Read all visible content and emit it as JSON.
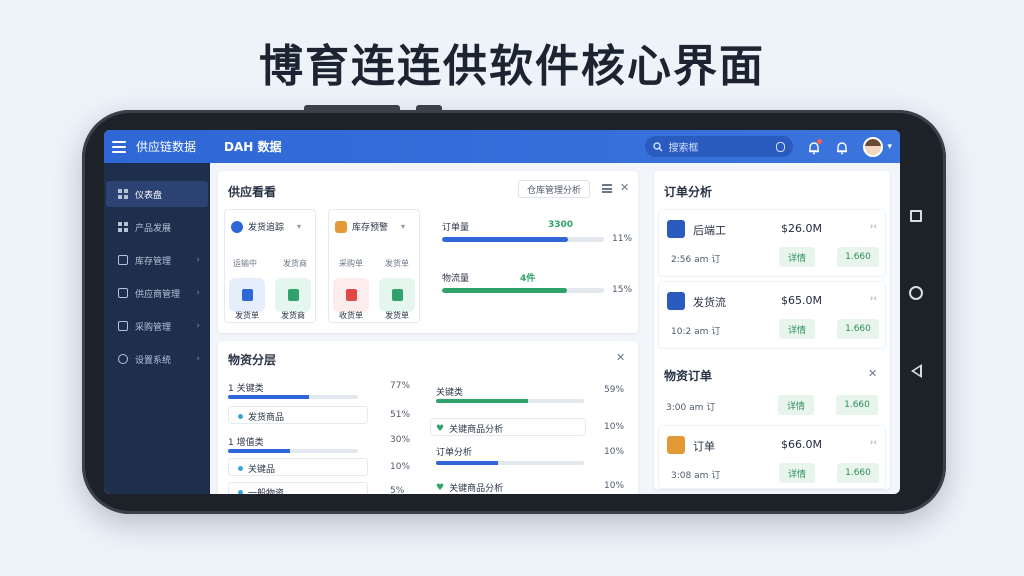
{
  "headline": "博育连连供软件核心界面",
  "topbar": {
    "app_title": "供应链数据",
    "page_title": "DAH 数据",
    "search_placeholder": "搜索框"
  },
  "sidebar": {
    "items": [
      {
        "label": "仪表盘",
        "arrow": ""
      },
      {
        "label": "产品发展",
        "arrow": ""
      },
      {
        "label": "库存管理",
        "arrow": "›"
      },
      {
        "label": "供应商管理",
        "arrow": "›"
      },
      {
        "label": "采购管理",
        "arrow": "›"
      },
      {
        "label": "设置系统",
        "arrow": "›"
      }
    ]
  },
  "warehouse": {
    "title": "供应看看",
    "tool_label": "仓库管理分析",
    "mini_a": {
      "head": "发货追踪",
      "sub1": "运输中",
      "sub2": "发货商",
      "tile1": "发货单",
      "tile2": "发货商"
    },
    "mini_b": {
      "head": "库存预警",
      "sub1": "采购单",
      "sub2": "发货单",
      "tile1": "收货单",
      "tile2": "发货单"
    },
    "meters": [
      {
        "label": "订单量",
        "value": "3300",
        "pct": "11%",
        "progress": 0.78,
        "color": "#2f67d6"
      },
      {
        "label": "物流量",
        "value": "4件",
        "pct": "15%",
        "progress": 0.77,
        "color": "#2fa36b"
      }
    ]
  },
  "category": {
    "title": "物资分层",
    "left_rows": [
      {
        "label": "1 关键类",
        "pct": "77%",
        "progress": 0.62,
        "type": "bar",
        "color": "#2f67d6"
      },
      {
        "label": "发货商品",
        "pct": "51%",
        "type": "box"
      },
      {
        "label": "1 增值类",
        "pct": "30%",
        "progress": 0.48,
        "type": "bar",
        "color": "#2f67d6"
      },
      {
        "label": "关键品",
        "pct": "10%",
        "type": "box"
      },
      {
        "label": "一般物资",
        "pct": "5%",
        "type": "box"
      }
    ],
    "right_rows": [
      {
        "label": "关键类",
        "pct": "59%",
        "progress": 0.62,
        "type": "bar",
        "color": "#2fa36b"
      },
      {
        "label": "关键商品分析",
        "pct": "10%",
        "type": "box"
      },
      {
        "label": "订单分析",
        "pct": "10%",
        "progress": 0.42,
        "type": "bar",
        "color": "#2f67d6"
      },
      {
        "label": "关键商品分析",
        "pct": "10%",
        "type": "box"
      }
    ]
  },
  "orders": {
    "title": "订单分析",
    "items": [
      {
        "name": "后端工",
        "amount": "$26.0M",
        "more": "›‹",
        "time": "2:56 am 订",
        "btn1": "详情",
        "btn2": "1.660",
        "icon_color": "#2a5bbf"
      },
      {
        "name": "发货流",
        "amount": "$65.0M",
        "more": "›‹",
        "time": "10:2 am 订",
        "btn1": "详情",
        "btn2": "1.660",
        "icon_color": "#2a5bbf"
      }
    ],
    "section2_title": "物资订单",
    "section2_row": {
      "time": "3:00 am 订",
      "btn1": "详情",
      "btn2": "1.660"
    },
    "item3": {
      "name": "订单",
      "amount": "$66.0M",
      "more": "›‹",
      "time": "3:08 am 订",
      "btn1": "详情",
      "btn2": "1.660",
      "icon_color": "#e39a36"
    }
  }
}
